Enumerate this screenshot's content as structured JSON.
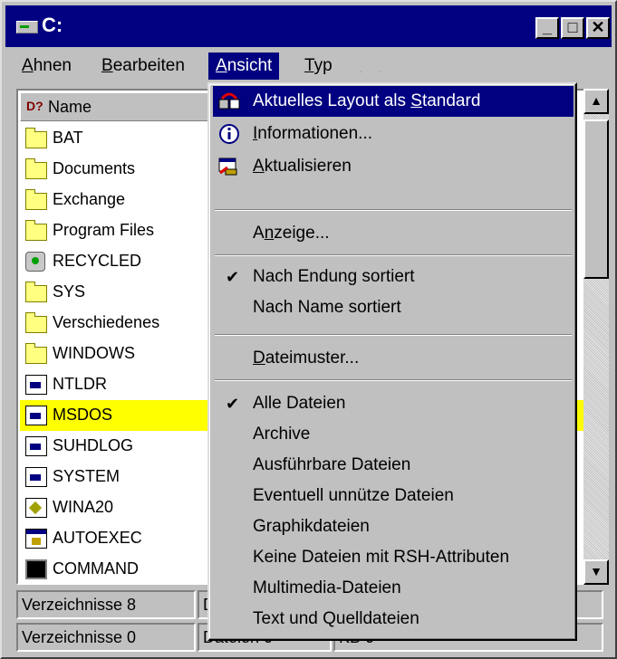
{
  "window": {
    "title": "C:"
  },
  "titlebar_buttons": {
    "minimize": "_",
    "maximize": "□",
    "close": "✕"
  },
  "menubar": {
    "items": [
      {
        "pre": "",
        "u": "A",
        "post": "hnen"
      },
      {
        "pre": "",
        "u": "B",
        "post": "earbeiten"
      },
      {
        "pre": "",
        "u": "A",
        "post": "nsicht"
      },
      {
        "pre": "",
        "u": "T",
        "post": "yp"
      }
    ]
  },
  "list": {
    "column_header": "Name",
    "rows": [
      {
        "name": "BAT",
        "icon": "folder-icon"
      },
      {
        "name": "Documents",
        "icon": "folder-icon"
      },
      {
        "name": "Exchange",
        "icon": "folder-icon"
      },
      {
        "name": "Program Files",
        "icon": "folder-icon"
      },
      {
        "name": "RECYCLED",
        "icon": "recycle-bin-icon"
      },
      {
        "name": "SYS",
        "icon": "folder-icon"
      },
      {
        "name": "Verschiedenes",
        "icon": "folder-icon"
      },
      {
        "name": "WINDOWS",
        "icon": "folder-icon"
      },
      {
        "name": "NTLDR",
        "icon": "system-file-icon"
      },
      {
        "name": "MSDOS",
        "icon": "system-file-icon",
        "selected": true
      },
      {
        "name": "SUHDLOG",
        "icon": "system-file-icon"
      },
      {
        "name": "SYSTEM",
        "icon": "system-file-icon"
      },
      {
        "name": "WINA20",
        "icon": "driver-file-icon"
      },
      {
        "name": "AUTOEXEC",
        "icon": "batch-file-icon"
      },
      {
        "name": "COMMAND",
        "icon": "command-file-icon"
      }
    ]
  },
  "status": {
    "row1": {
      "dirs": "Verzeichnisse 8",
      "files": "D"
    },
    "row2": {
      "dirs": "Verzeichnisse 0",
      "files": "Dateien 0",
      "size": "KB 0"
    }
  },
  "dropdown": {
    "items": [
      {
        "pre": "Aktuelles Layout als ",
        "u": "S",
        "post": "tandard",
        "icon": "layout-icon",
        "highlighted": true
      },
      {
        "pre": "",
        "u": "I",
        "post": "nformationen...",
        "icon": "info-icon"
      },
      {
        "pre": "",
        "u": "A",
        "post": "ktualisieren",
        "icon": "refresh-icon"
      },
      {
        "pre": "A",
        "u": "n",
        "post": "zeige..."
      },
      {
        "pre": "Nach Endung sortiert",
        "u": "",
        "post": "",
        "checked": true
      },
      {
        "pre": "Nach Name sortiert",
        "u": "",
        "post": ""
      },
      {
        "pre": "",
        "u": "D",
        "post": "ateimuster..."
      },
      {
        "pre": "Alle Dateien",
        "u": "",
        "post": "",
        "checked": true
      },
      {
        "pre": "Archive",
        "u": "",
        "post": ""
      },
      {
        "pre": "Ausführbare Dateien",
        "u": "",
        "post": ""
      },
      {
        "pre": "Eventuell unnütze Dateien",
        "u": "",
        "post": ""
      },
      {
        "pre": "Graphikdateien",
        "u": "",
        "post": ""
      },
      {
        "pre": "Keine Dateien mit RSH-Attributen",
        "u": "",
        "post": ""
      },
      {
        "pre": "Multimedia-Dateien",
        "u": "",
        "post": ""
      },
      {
        "pre": "Text und Quelldateien",
        "u": "",
        "post": ""
      }
    ]
  },
  "colors": {
    "titlebar": "#000080",
    "selection": "#ffff00",
    "menu_highlight": "#000080",
    "face": "#c0c0c0"
  }
}
